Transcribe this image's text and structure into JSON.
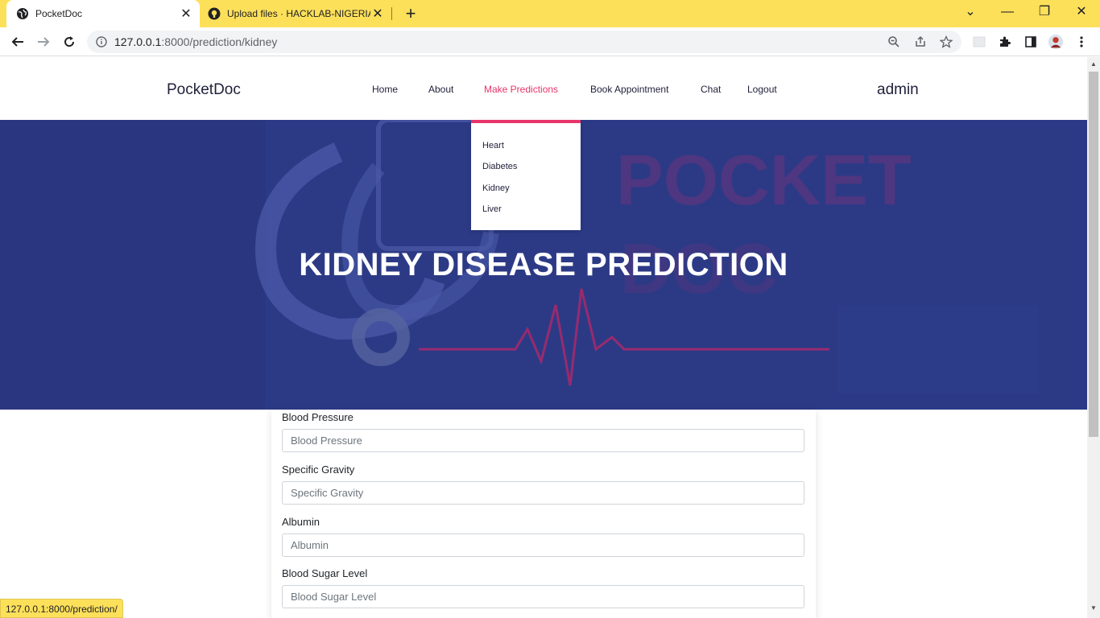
{
  "browser": {
    "tabs": [
      {
        "title": "PocketDoc",
        "favicon": "globe-icon",
        "active": true
      },
      {
        "title": "Upload files · HACKLAB-NIGERIA",
        "favicon": "github-icon",
        "active": false
      }
    ],
    "address": {
      "host": "127.0.0.1",
      "rest": ":8000/prediction/kidney"
    },
    "status_url": "127.0.0.1:8000/prediction/",
    "colors": {
      "frame": "#fde05a"
    }
  },
  "site": {
    "brand": "PocketDoc",
    "nav": {
      "home": "Home",
      "about": "About",
      "predictions": "Make Predictions",
      "appointment": "Book Appointment",
      "chat": "Chat",
      "logout": "Logout"
    },
    "user": "admin",
    "dropdown": [
      "Heart",
      "Diabetes",
      "Kidney",
      "Liver"
    ],
    "hero": {
      "title": "KIDNEY DISEASE PREDICTION",
      "watermark_1": "POCKET",
      "watermark_2": "DOC"
    },
    "colors": {
      "accent": "#e8346b",
      "hero_bg": "#2c3a86"
    }
  },
  "form": {
    "fields": [
      {
        "label": "Blood Pressure",
        "placeholder": "Blood Pressure",
        "value": ""
      },
      {
        "label": "Specific Gravity",
        "placeholder": "Specific Gravity",
        "value": ""
      },
      {
        "label": "Albumin",
        "placeholder": "Albumin",
        "value": ""
      },
      {
        "label": "Blood Sugar Level",
        "placeholder": "Blood Sugar Level",
        "value": ""
      }
    ]
  }
}
